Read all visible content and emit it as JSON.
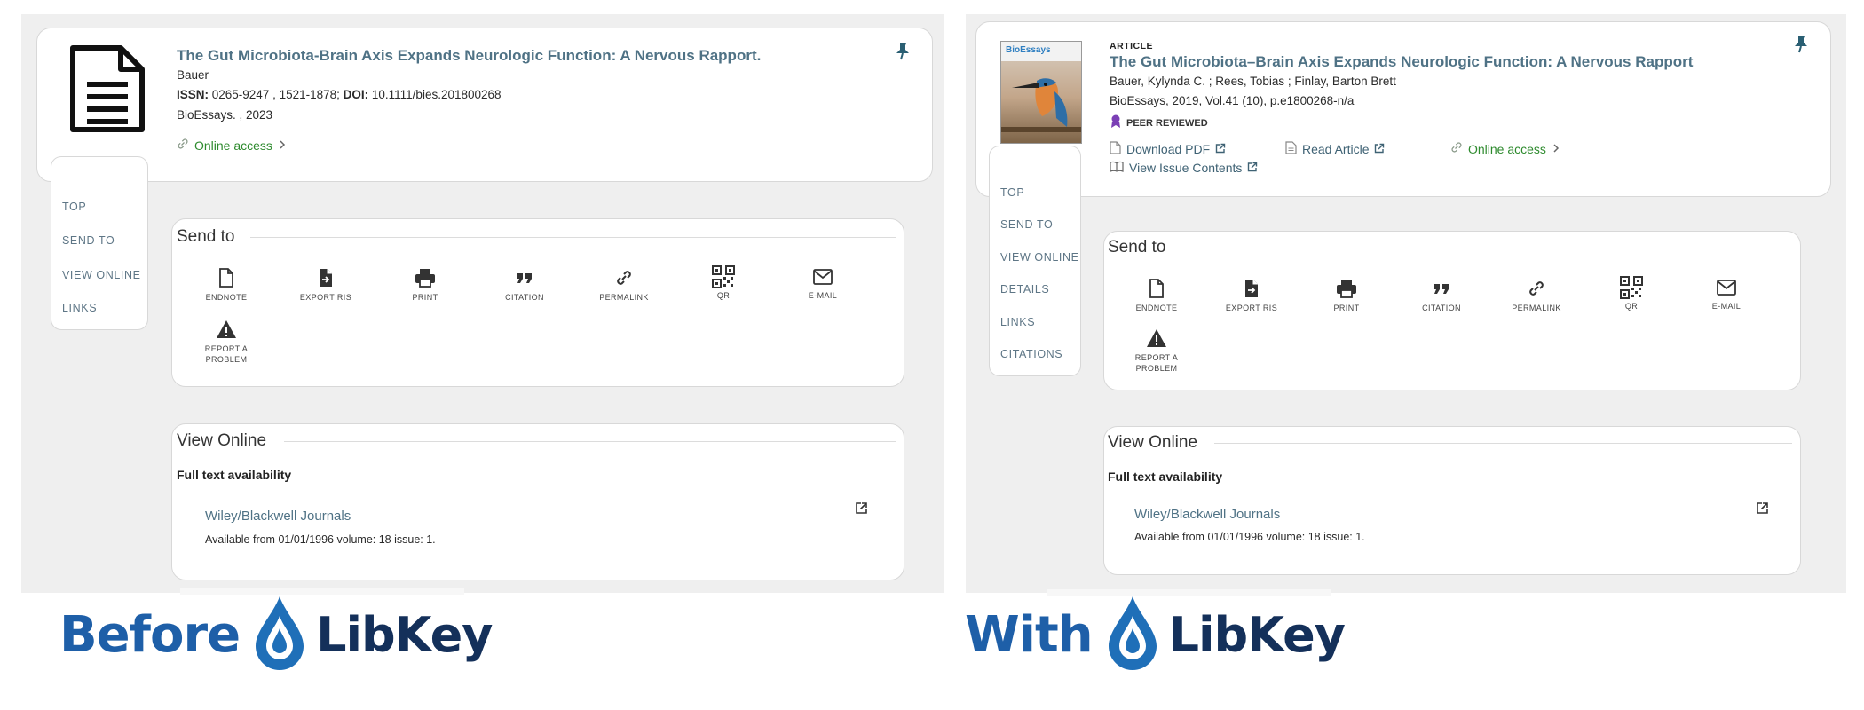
{
  "before": {
    "record": {
      "title": "The Gut Microbiota-Brain Axis Expands Neurologic Function: A Nervous Rapport.",
      "authors": "Bauer",
      "issn_label": "ISSN:",
      "issn_value": " 0265-9247 , 1521-1878; ",
      "doi_label": "DOI:",
      "doi_value": " 10.1111/bies.201800268",
      "source": "BioEssays. , 2023",
      "online_access": "Online access"
    },
    "nav": [
      "TOP",
      "SEND TO",
      "VIEW ONLINE",
      "LINKS"
    ],
    "send_to": {
      "title": "Send to",
      "actions": [
        {
          "label": "ENDNOTE",
          "icon": "endnote-icon"
        },
        {
          "label": "EXPORT RIS",
          "icon": "export-ris-icon"
        },
        {
          "label": "PRINT",
          "icon": "print-icon"
        },
        {
          "label": "CITATION",
          "icon": "citation-icon"
        },
        {
          "label": "PERMALINK",
          "icon": "permalink-icon"
        },
        {
          "label": "QR",
          "icon": "qr-icon"
        },
        {
          "label": "E-MAIL",
          "icon": "email-icon"
        },
        {
          "label": "REPORT A PROBLEM",
          "icon": "warning-icon"
        }
      ]
    },
    "view_online": {
      "title": "View Online",
      "availability_heading": "Full text availability",
      "provider": "Wiley/Blackwell Journals",
      "availability": "Available from 01/01/1996 volume: 18 issue: 1."
    },
    "brand": {
      "word": "Before",
      "product": "LibKey"
    }
  },
  "with": {
    "record": {
      "type": "ARTICLE",
      "title": "The Gut Microbiota–Brain Axis Expands Neurologic Function: A Nervous Rapport",
      "authors": "Bauer, Kylynda C. ; Rees, Tobias ; Finlay, Barton Brett",
      "source": "BioEssays, 2019, Vol.41 (10), p.e1800268-n/a",
      "peer_reviewed": "PEER REVIEWED",
      "cover_title": "BioEssays",
      "download_pdf": "Download PDF",
      "read_article": "Read Article",
      "online_access": "Online access",
      "view_issue": "View Issue Contents"
    },
    "nav": [
      "TOP",
      "SEND TO",
      "VIEW ONLINE",
      "DETAILS",
      "LINKS",
      "CITATIONS"
    ],
    "send_to": {
      "title": "Send to",
      "actions": [
        {
          "label": "ENDNOTE",
          "icon": "endnote-icon"
        },
        {
          "label": "EXPORT RIS",
          "icon": "export-ris-icon"
        },
        {
          "label": "PRINT",
          "icon": "print-icon"
        },
        {
          "label": "CITATION",
          "icon": "citation-icon"
        },
        {
          "label": "PERMALINK",
          "icon": "permalink-icon"
        },
        {
          "label": "QR",
          "icon": "qr-icon"
        },
        {
          "label": "E-MAIL",
          "icon": "email-icon"
        },
        {
          "label": "REPORT A PROBLEM",
          "icon": "warning-icon"
        }
      ]
    },
    "view_online": {
      "title": "View Online",
      "availability_heading": "Full text availability",
      "provider": "Wiley/Blackwell Journals",
      "availability": "Available from 01/01/1996 volume: 18 issue: 1."
    },
    "brand": {
      "word": "With",
      "product": "LibKey"
    }
  },
  "colors": {
    "panel_bg": "#efefef",
    "title_link": "#4f7285",
    "online_access_green": "#2d8a2d",
    "peer_reviewed_purple": "#7b3fb5",
    "brand_blue": "#1e5fa8",
    "brand_navy": "#14305a"
  }
}
